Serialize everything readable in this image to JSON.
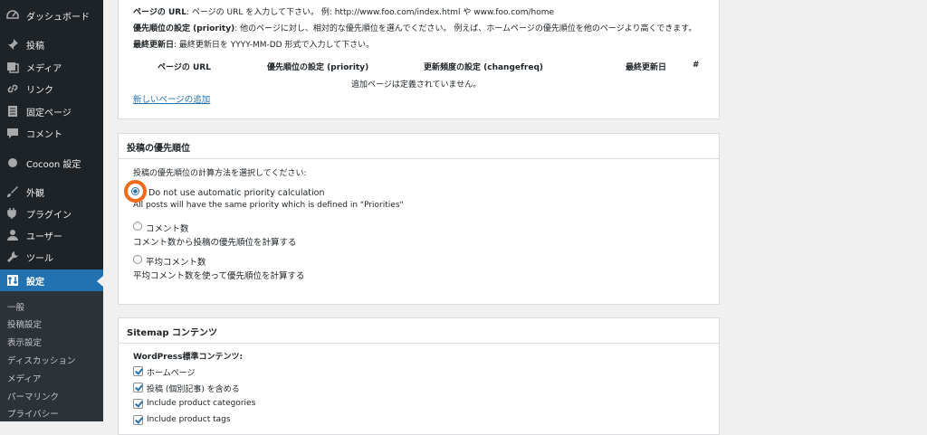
{
  "sidebar": {
    "items": [
      {
        "label": "ダッシュボード",
        "icon": "dashboard-icon"
      },
      {
        "label": "投稿",
        "icon": "pin-icon"
      },
      {
        "label": "メディア",
        "icon": "media-icon"
      },
      {
        "label": "リンク",
        "icon": "link-icon"
      },
      {
        "label": "固定ページ",
        "icon": "page-icon"
      },
      {
        "label": "コメント",
        "icon": "comment-icon"
      },
      {
        "label": "Cocoon 設定",
        "icon": "cocoon-icon"
      },
      {
        "label": "外観",
        "icon": "appearance-icon"
      },
      {
        "label": "プラグイン",
        "icon": "plugin-icon"
      },
      {
        "label": "ユーザー",
        "icon": "user-icon"
      },
      {
        "label": "ツール",
        "icon": "tool-icon"
      },
      {
        "label": "設定",
        "icon": "settings-icon"
      }
    ],
    "submenu": [
      "一般",
      "投稿設定",
      "表示設定",
      "ディスカッション",
      "メディア",
      "パーマリンク",
      "プライバシー"
    ]
  },
  "additional_pages": {
    "url_line_label": "ページの URL",
    "url_line_text": ": ページの URL を入力して下さい。 例: http://www.foo.com/index.html や www.foo.com/home",
    "priority_line_label": "優先順位の設定 (priority)",
    "priority_line_text": ": 他のページに対し、相対的な優先順位を選んでください。 例えば、ホームページの優先順位を他のページより高くできます。",
    "lastmod_line_label": "最終更新日",
    "lastmod_line_text": ": 最終更新日を YYYY-MM-DD 形式で入力して下さい。",
    "columns": [
      "ページの URL",
      "優先順位の設定 (priority)",
      "更新頻度の設定 (changefreq)",
      "最終更新日",
      "#"
    ],
    "empty_message": "追加ページは定義されていません。",
    "add_link": "新しいページの追加"
  },
  "priority_panel": {
    "title": "投稿の優先順位",
    "instruction": "投稿の優先順位の計算方法を選択してください:",
    "options": [
      {
        "label": "Do not use automatic priority calculation",
        "description": "All posts will have the same priority which is defined in \"Priorities\"",
        "selected": true
      },
      {
        "label": "コメント数",
        "description": "コメント数から投稿の優先順位を計算する",
        "selected": false
      },
      {
        "label": "平均コメント数",
        "description": "平均コメント数を使って優先順位を計算する",
        "selected": false
      }
    ]
  },
  "sitemap_panel": {
    "title": "Sitemap コンテンツ",
    "subtitle": "WordPress標準コンテンツ:",
    "checkboxes": [
      {
        "label": "ホームページ",
        "checked": true
      },
      {
        "label": "投稿 (個別記事) を含める",
        "checked": true
      },
      {
        "label": "Include product categories",
        "checked": true
      },
      {
        "label": "Include product tags",
        "checked": true
      }
    ]
  },
  "colors": {
    "accent": "#2271b1",
    "highlight": "#f26a1b",
    "sidebar": "#1d2327"
  }
}
